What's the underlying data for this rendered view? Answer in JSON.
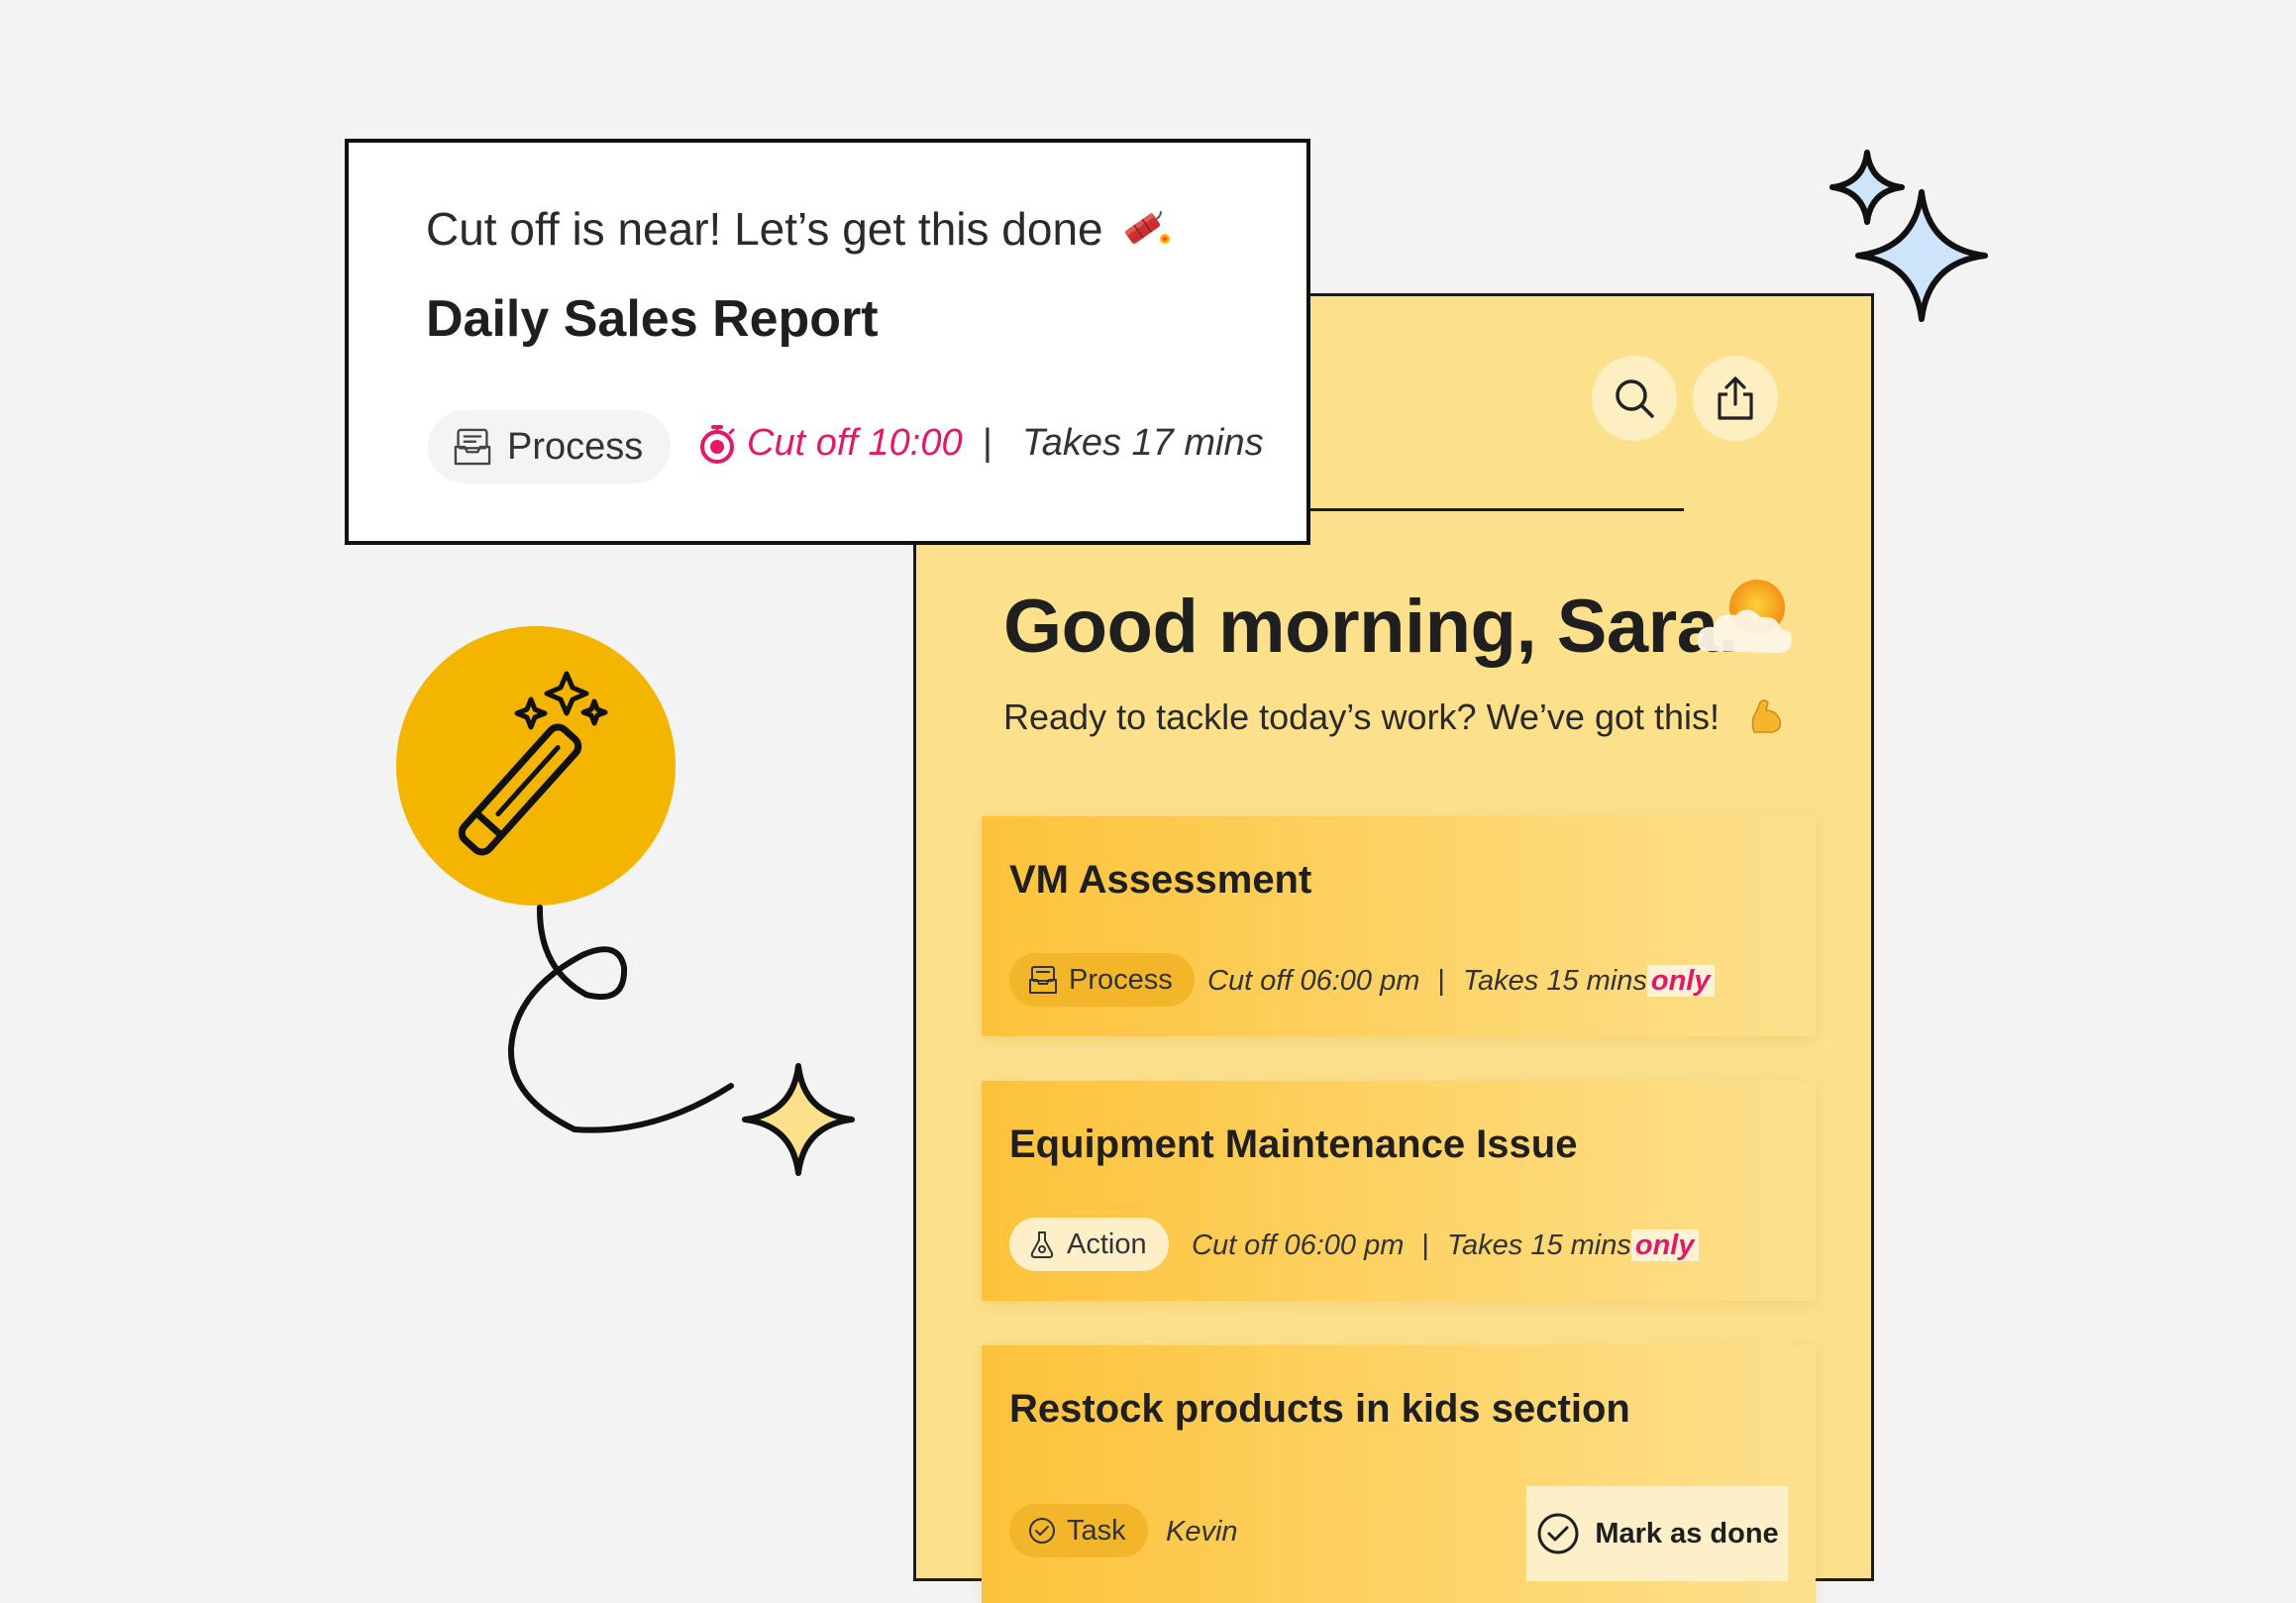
{
  "notification": {
    "message": "Cut off is near! Let’s get this done",
    "title": "Daily Sales Report",
    "type_label": "Process",
    "cutoff": "Cut off 10:00",
    "separator": "|",
    "duration": "Takes 17 mins"
  },
  "home": {
    "greeting": "Good morning, Sara.",
    "subtitle": "Ready to tackle today’s work? We’ve got this!",
    "tasks": [
      {
        "title": "VM Assessment",
        "type": "Process",
        "cutoff": "Cut off 06:00 pm",
        "separator": "|",
        "duration": "Takes 15 mins",
        "emphasis": "only"
      },
      {
        "title": "Equipment Maintenance Issue",
        "type": "Action",
        "cutoff": "Cut off 06:00 pm",
        "separator": "|",
        "duration": "Takes 15 mins",
        "emphasis": "only"
      },
      {
        "title": "Restock products in kids section",
        "type": "Task",
        "assignee": "Kevin",
        "action_label": "Mark as done"
      }
    ]
  },
  "icons": {
    "search": "search-icon",
    "share": "share-icon",
    "process": "inbox-tray-icon",
    "action": "flask-icon",
    "task": "check-circle-icon",
    "cutoff": "stopwatch-icon",
    "dynamite": "dynamite-icon",
    "weather": "sun-behind-cloud-icon",
    "muscle": "flexed-biceps-icon",
    "wand": "magic-wand-icon",
    "sparkle": "sparkle-icon"
  },
  "colors": {
    "background": "#f3f3f3",
    "panel": "#fde08c",
    "accent_pink": "#e2186b",
    "wand_circle": "#f3b500",
    "card_start": "#fdc23a",
    "sparkle_blue": "#cde4fb",
    "sparkle_yellow": "#fce08a"
  }
}
